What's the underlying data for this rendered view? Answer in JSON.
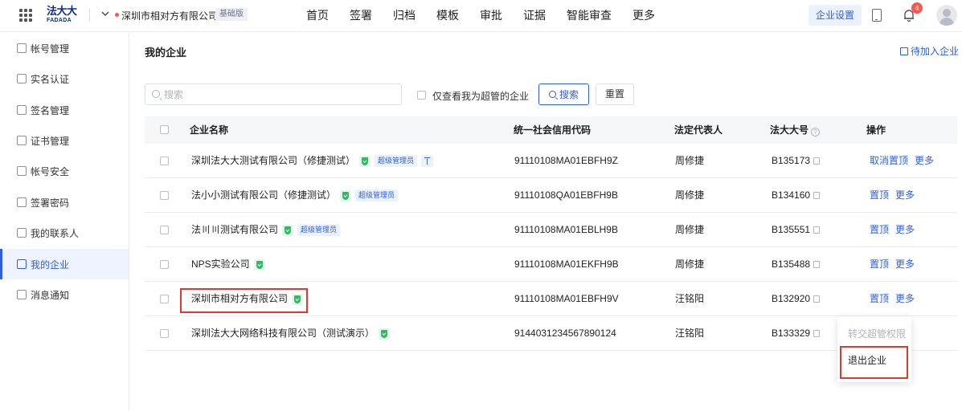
{
  "header": {
    "logo_cn": "法大大",
    "logo_en": "FADADA",
    "org_name": "深圳市相对方有限公司",
    "plan_badge": "基础版",
    "nav": [
      "首页",
      "签署",
      "归档",
      "模板",
      "审批",
      "证据",
      "智能审查",
      "更多"
    ],
    "settings_label": "企业设置",
    "notification_count": "4"
  },
  "sidebar": {
    "items": [
      {
        "label": "帐号管理",
        "active": false
      },
      {
        "label": "实名认证",
        "active": false
      },
      {
        "label": "签名管理",
        "active": false
      },
      {
        "label": "证书管理",
        "active": false
      },
      {
        "label": "帐号安全",
        "active": false
      },
      {
        "label": "签署密码",
        "active": false
      },
      {
        "label": "我的联系人",
        "active": false
      },
      {
        "label": "我的企业",
        "active": true
      },
      {
        "label": "消息通知",
        "active": false
      }
    ]
  },
  "main": {
    "title": "我的企业",
    "pending_link": "待加入企业",
    "search_placeholder": "搜索",
    "filter_label": "仅查看我为超管的企业",
    "search_button": "搜索",
    "reset_button": "重置",
    "columns": {
      "name": "企业名称",
      "credit_code": "统一社会信用代码",
      "legal_rep": "法定代表人",
      "fdd_id": "法大大号",
      "actions": "操作"
    },
    "rows": [
      {
        "name": "深圳法大大测试有限公司（修捷测试）",
        "verified": true,
        "admin_tag": "超级管理员",
        "pinned": true,
        "credit_code": "91110108MA01EBFH9Z",
        "legal_rep": "周修捷",
        "fdd_id": "B135173",
        "action1": "取消置顶",
        "action2": "更多"
      },
      {
        "name": "法小小测试有限公司（修捷测试）",
        "verified": true,
        "admin_tag": "超级管理员",
        "pinned": false,
        "credit_code": "91110108QA01EBFH9B",
        "legal_rep": "周修捷",
        "fdd_id": "B134160",
        "action1": "置顶",
        "action2": "更多"
      },
      {
        "name": "法〣〣测试有限公司",
        "verified": true,
        "admin_tag": "超级管理员",
        "pinned": false,
        "credit_code": "91110108MA01EBLH9B",
        "legal_rep": "周修捷",
        "fdd_id": "B135551",
        "action1": "置顶",
        "action2": "更多"
      },
      {
        "name": "NPS实验公司",
        "verified": true,
        "admin_tag": "",
        "pinned": false,
        "credit_code": "91110108MA01EKFH9B",
        "legal_rep": "周修捷",
        "fdd_id": "B135488",
        "action1": "置顶",
        "action2": "更多"
      },
      {
        "name": "深圳市相对方有限公司",
        "verified": true,
        "admin_tag": "",
        "pinned": false,
        "credit_code": "91110108MA01EBFH9V",
        "legal_rep": "汪铭阳",
        "fdd_id": "B132920",
        "action1": "置顶",
        "action2": "更多"
      },
      {
        "name": "深圳法大大网络科技有限公司（测试演示）",
        "verified": true,
        "admin_tag": "",
        "pinned": false,
        "credit_code": "9144031234567890124",
        "legal_rep": "汪铭阳",
        "fdd_id": "B133329",
        "action1": "",
        "action2": ""
      }
    ],
    "dropdown": {
      "transfer": "转交超管权限",
      "exit": "退出企业"
    }
  },
  "colors": {
    "primary": "#2f5fe0",
    "highlight": "#e03a2f",
    "verified": "#35b768"
  }
}
